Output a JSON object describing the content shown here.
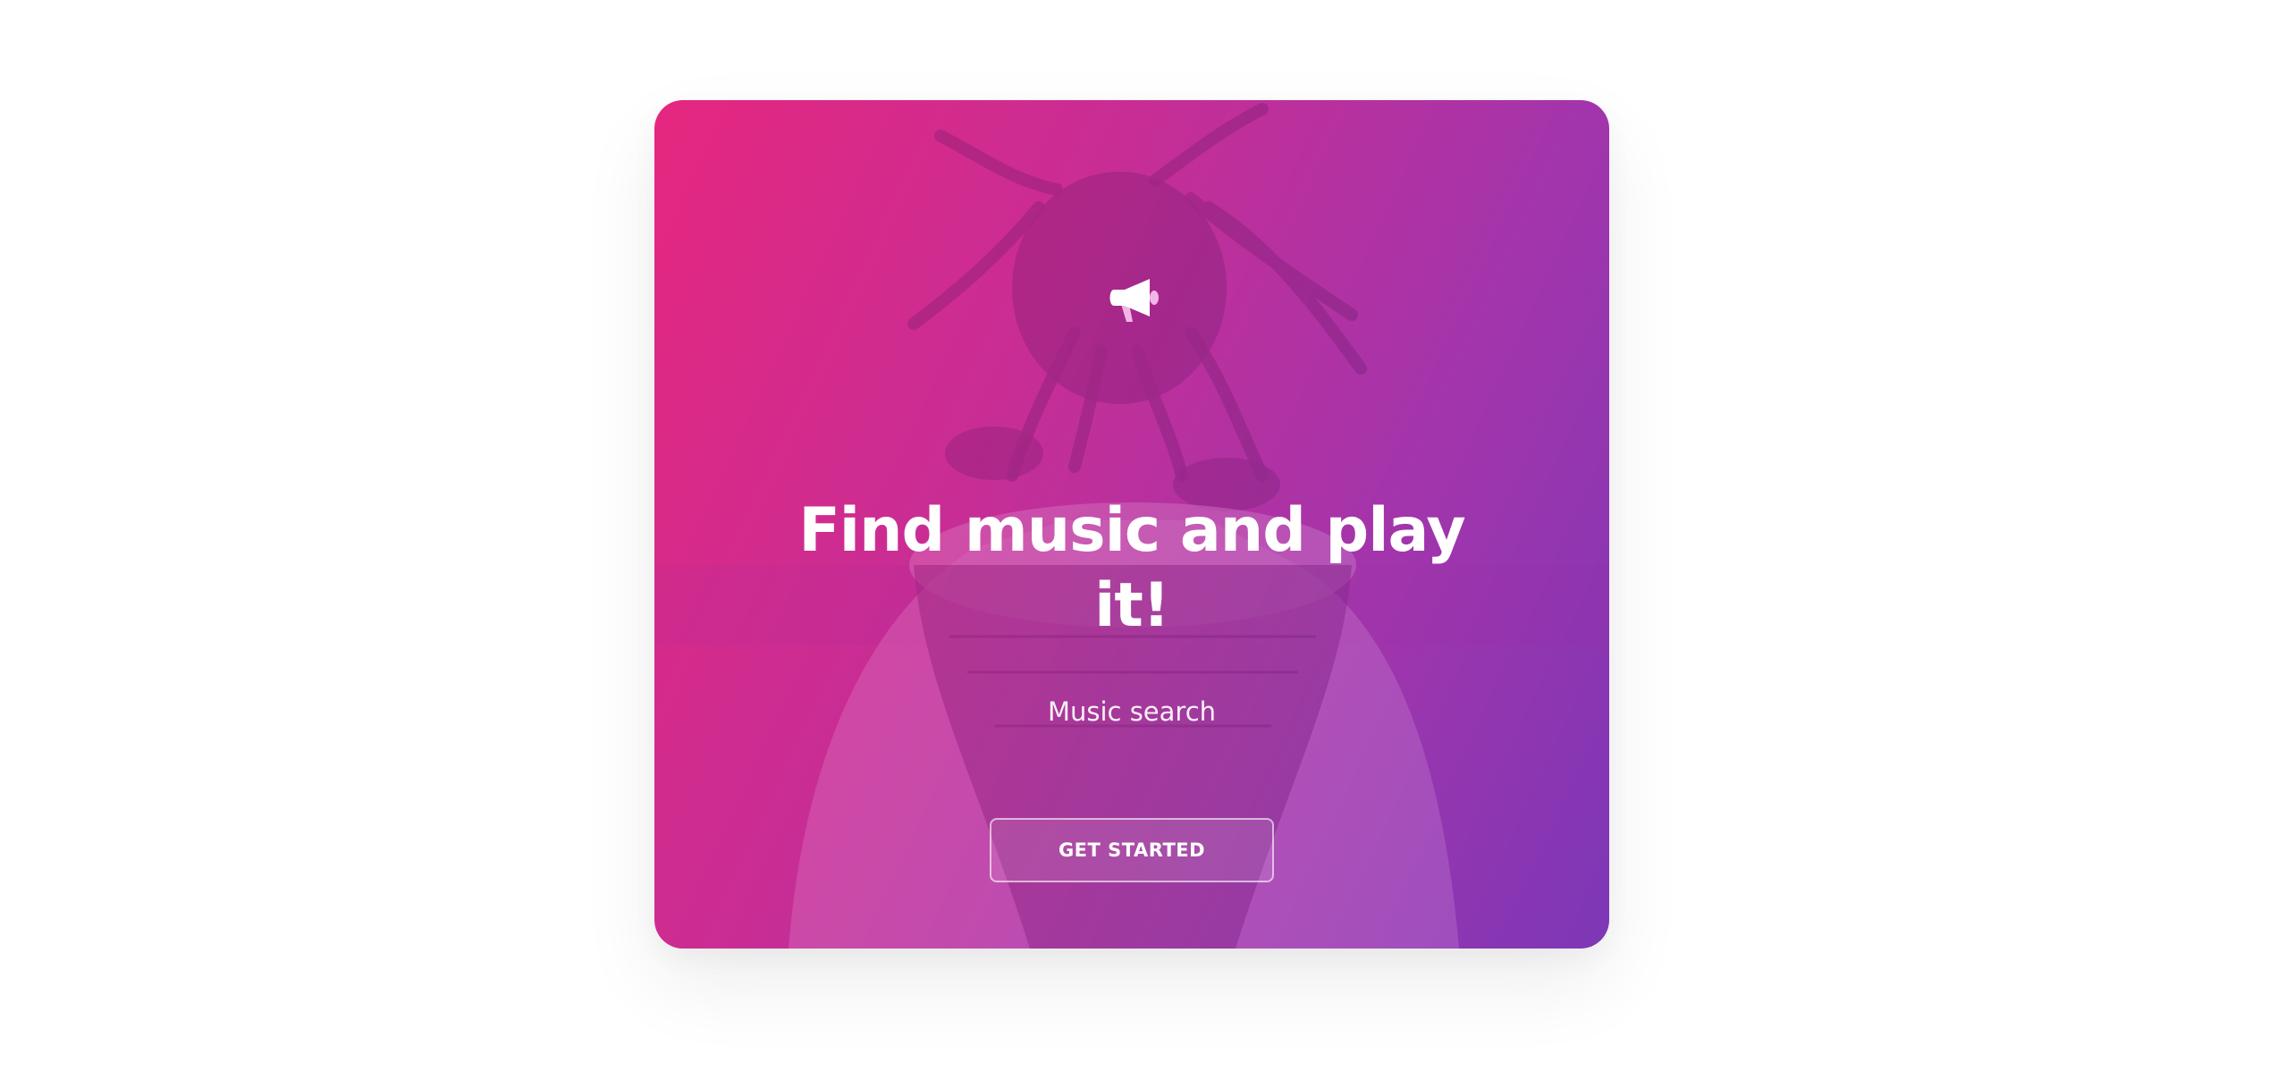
{
  "hero": {
    "icon": "megaphone-icon",
    "title": "Find music and play it!",
    "subtitle": "Music search",
    "cta_label": "GET STARTED"
  },
  "colors": {
    "gradient_start": "#e5277f",
    "gradient_mid": "#a235ac",
    "gradient_end": "#7d37b6",
    "text": "#ffffff"
  }
}
